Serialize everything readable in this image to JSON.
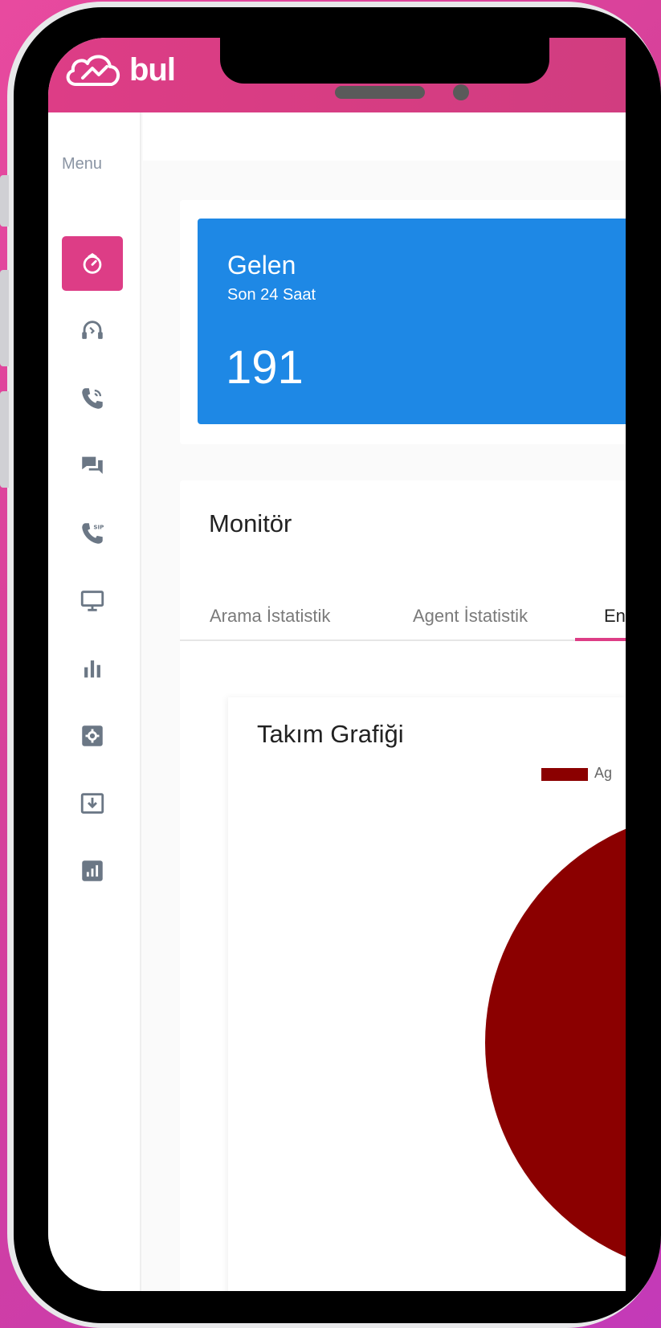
{
  "app": {
    "logo_text": "bul",
    "icons": [
      "cloud-logo-icon"
    ]
  },
  "sidebar": {
    "menu_title": "Menu",
    "items": [
      {
        "icon": "dashboard-icon",
        "active": true
      },
      {
        "icon": "headset-icon",
        "active": false
      },
      {
        "icon": "phone-call-icon",
        "active": false
      },
      {
        "icon": "chat-icon",
        "active": false
      },
      {
        "icon": "sip-phone-icon",
        "active": false
      },
      {
        "icon": "monitor-icon",
        "active": false
      },
      {
        "icon": "bar-chart-icon",
        "active": false
      },
      {
        "icon": "settings-icon",
        "active": false
      },
      {
        "icon": "download-icon",
        "active": false
      },
      {
        "icon": "report-icon",
        "active": false
      }
    ]
  },
  "stats": {
    "incoming": {
      "title": "Gelen",
      "subtitle": "Son 24 Saat",
      "value": "191"
    }
  },
  "monitor": {
    "title": "Monitör",
    "tabs": [
      {
        "label": "Arama İstatistik",
        "active": false
      },
      {
        "label": "Agent İstatistik",
        "active": false
      },
      {
        "label": "En",
        "active": true
      }
    ]
  },
  "chart": {
    "title": "Takım Grafiği",
    "legend_label": "Ag"
  },
  "chart_data": {
    "type": "pie",
    "title": "Takım Grafiği",
    "labels": [
      "Ag"
    ],
    "values": [
      100
    ],
    "colors": [
      "#8b0000"
    ],
    "legend": "top-right"
  },
  "colors": {
    "brand": "#dd3d86",
    "stat_blue": "#1e88e5",
    "pie_series": "#8b0000",
    "sidebar_icon": "#6b7785"
  }
}
